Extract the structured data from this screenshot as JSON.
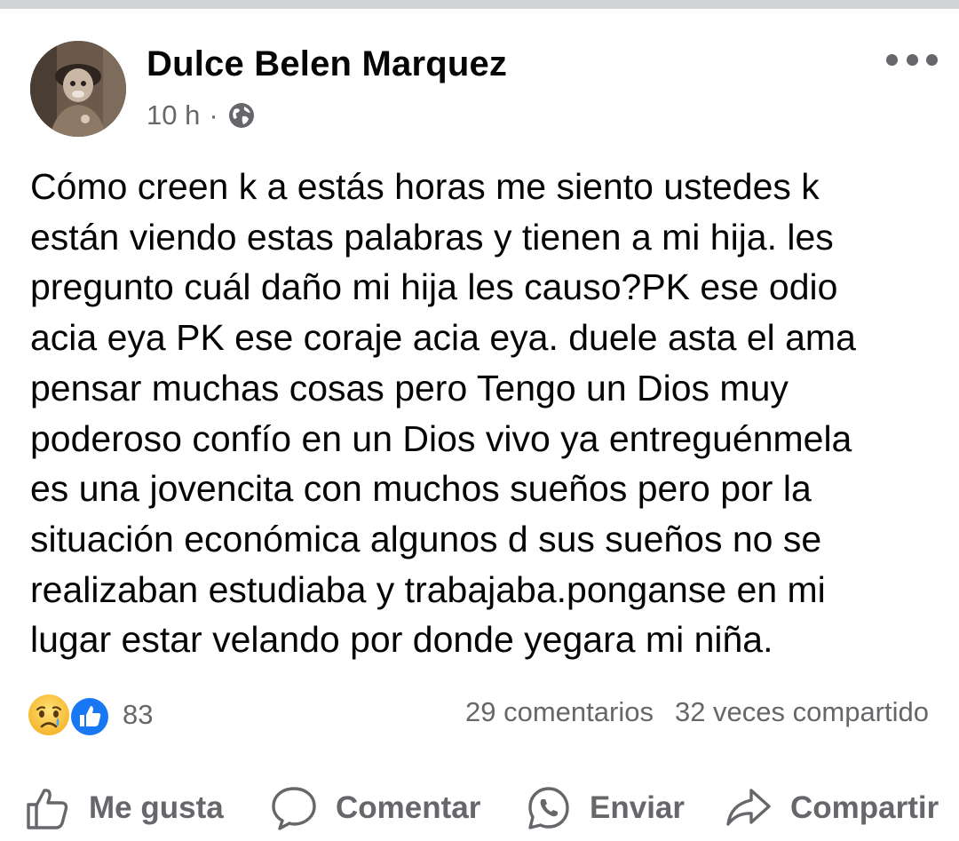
{
  "post": {
    "author": "Dulce Belen Marquez",
    "time": "10 h",
    "separator": "·",
    "privacy_icon": "globe-icon",
    "menu_icon": "more-options-icon",
    "body_lines": [
      "Cómo creen k a estás horas me siento ustedes k",
      "están viendo estas palabras y tienen a mi hija. les",
      "pregunto cuál daño mi hija les causo?PK ese odio",
      "acia eya PK ese coraje acia eya. duele asta el ama",
      "pensar muchas cosas pero Tengo un Dios muy",
      "poderoso confío en un Dios vivo ya entreguénmela",
      "es una jovencita con muchos sueños pero por la",
      "situación económica algunos d sus sueños no se",
      "realizaban estudiaba y trabajaba.ponganse en mi",
      "lugar estar velando por donde yegara mi niña."
    ]
  },
  "reactions": {
    "icons": [
      "sad-face-icon",
      "like-reaction-icon"
    ],
    "count": "83"
  },
  "stats": {
    "comments": "29 comentarios",
    "shares": "32 veces compartido"
  },
  "actions": {
    "like": "Me gusta",
    "comment": "Comentar",
    "send": "Enviar",
    "share": "Compartir"
  },
  "colors": {
    "text": "#050505",
    "secondary": "#65676b",
    "like_blue": "#1877f2",
    "top_bar": "#d2d3d7"
  }
}
